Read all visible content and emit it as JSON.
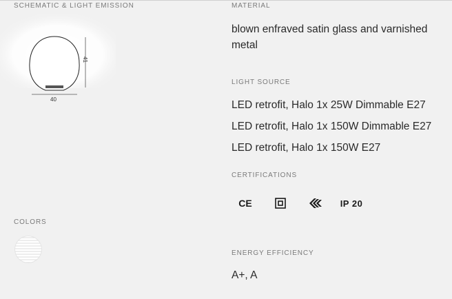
{
  "schematic": {
    "heading": "SCHEMATIC & LIGHT EMISSION",
    "height_label": "41",
    "width_label": "40"
  },
  "material": {
    "heading": "MATERIAL",
    "value": "blown enfraved satin glass and varnished metal"
  },
  "light_source": {
    "heading": "LIGHT SOURCE",
    "items": [
      "LED retrofit, Halo 1x 25W Dimmable E27",
      "LED retrofit, Halo 1x 150W Dimmable E27",
      "LED retrofit, Halo 1x 150W E27"
    ]
  },
  "certifications": {
    "heading": "CERTIFICATIONS",
    "ce_mark": "CE",
    "ip_rating": "IP 20",
    "icons": [
      "ce-mark-icon",
      "class-ii-double-insulation-icon",
      "emc-mark-icon"
    ]
  },
  "colors": {
    "heading": "COLORS",
    "swatches": [
      {
        "icon": "white-satin-glass-swatch"
      }
    ]
  },
  "energy": {
    "heading": "ENERGY EFFICIENCY",
    "value": "A+, A"
  }
}
